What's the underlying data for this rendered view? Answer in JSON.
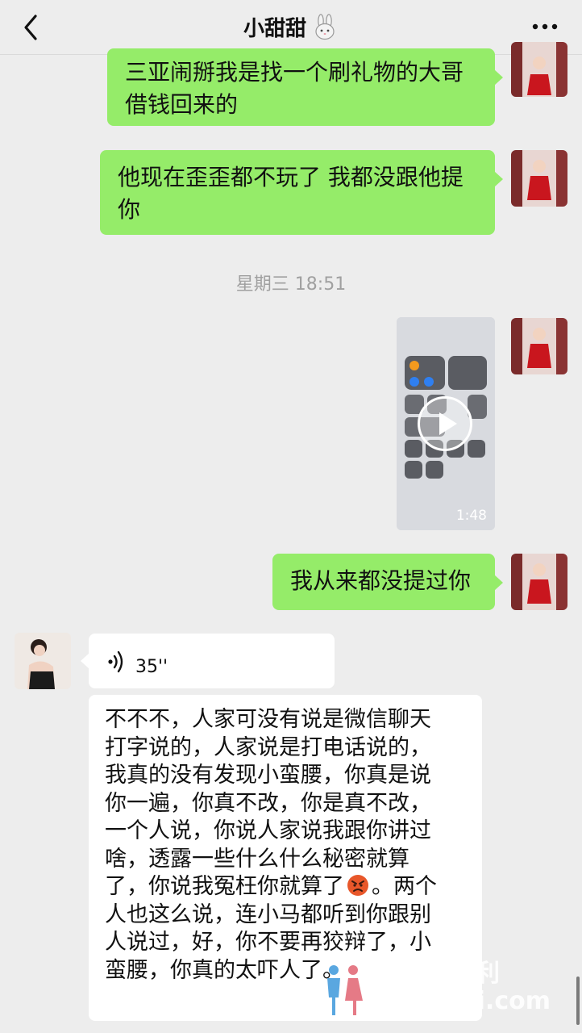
{
  "header": {
    "title": "小甜甜",
    "title_emoji": "bunny-icon",
    "back_icon": "chevron-left-icon",
    "more_icon": "more-dots-icon"
  },
  "messages": [
    {
      "side": "me",
      "type": "text",
      "text_lines": [
        "三亚闹掰我是找一个刷礼物的大哥",
        "借钱回来的"
      ]
    },
    {
      "side": "me",
      "type": "text",
      "text_lines": [
        "他现在歪歪都不玩了 我都没跟他提",
        "你"
      ]
    },
    {
      "type": "timestamp",
      "text": "星期三 18:51"
    },
    {
      "side": "me",
      "type": "video",
      "duration": "1:48"
    },
    {
      "side": "me",
      "type": "text",
      "text_lines": [
        "我从来都没提过你"
      ]
    },
    {
      "side": "other",
      "type": "voice",
      "duration": "35''"
    },
    {
      "side": "other",
      "type": "text",
      "text_lines": [
        "不不不，人家可没有说是微信聊天",
        "打字说的，人家说是打电话说的，",
        "我真的没有发现小蛮腰，你真是说",
        "你一遍，你真不改，你是真不改，",
        "一个人说，你说人家说我跟你讲过",
        "啥，透露一些什么什么秘密就算",
        "了，你说我冤枉你就算了",
        "。两个",
        "人也这么说，连小马都听到你跟别",
        "人说过，好，你不要再狡辩了，小",
        "蛮腰，你真的太吓人了。"
      ],
      "emoji": "angry-face-icon"
    }
  ],
  "watermark": {
    "line1": "福利",
    "line2": "uli.com"
  },
  "colors": {
    "me_bubble": "#95ec69",
    "other_bubble": "#ffffff",
    "background": "#ededed"
  }
}
